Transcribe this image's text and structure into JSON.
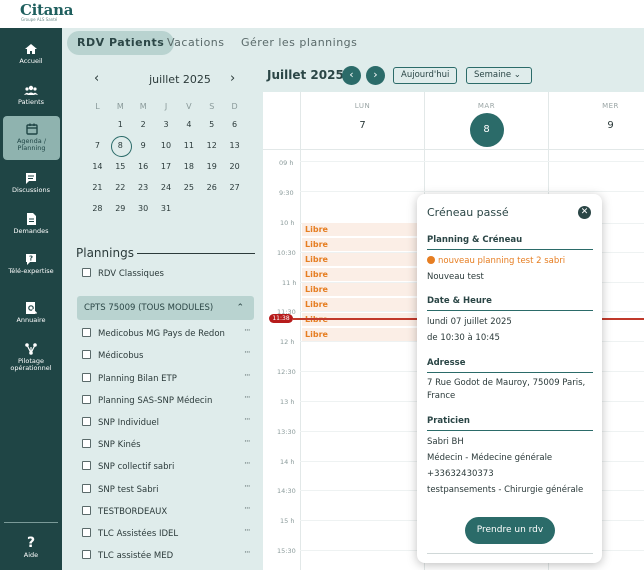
{
  "brand": {
    "name": "Citana",
    "tagline": "Groupe ALS Santé"
  },
  "sidebar": {
    "items": [
      {
        "label": "Accueil",
        "icon": "home-icon"
      },
      {
        "label": "Patients",
        "icon": "patients-icon"
      },
      {
        "label": "Agenda / Planning",
        "icon": "calendar-icon"
      },
      {
        "label": "Discussions",
        "icon": "chat-icon"
      },
      {
        "label": "Demandes",
        "icon": "document-icon"
      },
      {
        "label": "Télé-expertise",
        "icon": "question-bubble-icon"
      },
      {
        "label": "Annuaire",
        "icon": "directory-search-icon"
      },
      {
        "label": "Pilotage opérationnel",
        "icon": "network-icon"
      }
    ],
    "help_label": "Aide"
  },
  "tabs": [
    {
      "label": "RDV Patients",
      "active": true
    },
    {
      "label": "Vacations",
      "active": false
    },
    {
      "label": "Gérer les plannings",
      "active": false
    }
  ],
  "mini_calendar": {
    "month": "juillet 2025",
    "weekdays": [
      "L",
      "M",
      "M",
      "J",
      "V",
      "S",
      "D"
    ],
    "weeks": [
      [
        "",
        "1",
        "2",
        "3",
        "4",
        "5",
        "6"
      ],
      [
        "7",
        "8",
        "9",
        "10",
        "11",
        "12",
        "13"
      ],
      [
        "14",
        "15",
        "16",
        "17",
        "18",
        "19",
        "20"
      ],
      [
        "21",
        "22",
        "23",
        "24",
        "25",
        "26",
        "27"
      ],
      [
        "28",
        "29",
        "30",
        "31",
        "",
        "",
        ""
      ]
    ],
    "selected": "8"
  },
  "plannings": {
    "title": "Plannings",
    "standalone": "RDV Classiques",
    "group_label": "CPTS 75009 (TOUS MODULES)",
    "items": [
      "Medicobus MG Pays de Redon",
      "Médicobus",
      "Planning Bilan ETP",
      "Planning SAS-SNP Médecin",
      "SNP Individuel",
      "SNP Kinés",
      "SNP collectif sabri",
      "SNP test Sabri",
      "TESTBORDEAUX",
      "TLC Assistées IDEL",
      "TLC assistée MED"
    ],
    "more_label": "···"
  },
  "calendar": {
    "title": "Juillet 2025",
    "prev": "‹",
    "next": "›",
    "today_label": "Aujourd'hui",
    "view_label": "Semaine ⌄",
    "days": [
      {
        "name": "LUN",
        "num": "7"
      },
      {
        "name": "MAR",
        "num": "8"
      },
      {
        "name": "MER",
        "num": "9"
      }
    ],
    "hours": [
      "09 h",
      "9:30",
      "10 h",
      "10:30",
      "11 h",
      "11:30",
      "12 h",
      "12:30",
      "13 h",
      "13:30",
      "14 h",
      "14:30",
      "15 h",
      "15:30"
    ],
    "slot_label": "Libre",
    "now_time": "11:38"
  },
  "popup": {
    "title": "Créneau passé",
    "close": "✕",
    "section_planning": "Planning & Créneau",
    "planning_name": "nouveau planning test 2 sabri",
    "slot_name": "Nouveau test",
    "section_date": "Date & Heure",
    "date": "lundi 07 juillet 2025",
    "time": "de 10:30 à 10:45",
    "section_address": "Adresse",
    "address": "7 Rue Godot de Mauroy, 75009 Paris, France",
    "section_practitioner": "Praticien",
    "practitioner_name": "Sabri BH",
    "practitioner_spec": "Médecin - Médecine générale",
    "practitioner_phone": "+33632430373",
    "practitioner_other": "testpansements - Chirurgie générale",
    "cta": "Prendre un rdv"
  },
  "colors": {
    "primary": "#2b6b69",
    "sidebar": "#1f4545",
    "accent": "#e67e22",
    "now": "#c0392b"
  }
}
